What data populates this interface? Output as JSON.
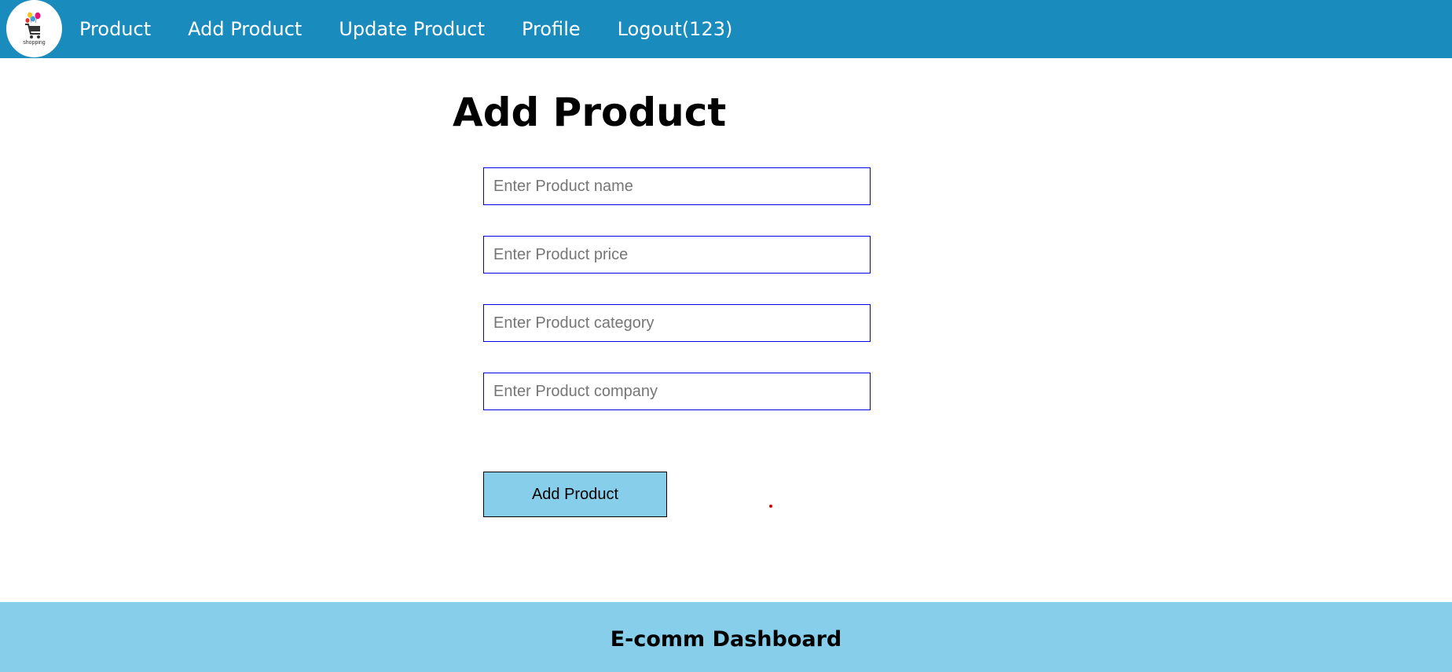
{
  "nav": {
    "logo": {
      "icon": "shopping-cart-balloons-icon",
      "text": "shopping"
    },
    "items": [
      {
        "label": "Product"
      },
      {
        "label": "Add Product"
      },
      {
        "label": "Update Product"
      },
      {
        "label": "Profile"
      },
      {
        "label": "Logout(123)"
      }
    ]
  },
  "main": {
    "title": "Add Product",
    "fields": {
      "name": {
        "value": "",
        "placeholder": "Enter Product name"
      },
      "price": {
        "value": "",
        "placeholder": "Enter Product price"
      },
      "category": {
        "value": "",
        "placeholder": "Enter Product category"
      },
      "company": {
        "value": "",
        "placeholder": "Enter Product company"
      }
    },
    "submit_label": "Add Product"
  },
  "footer": {
    "text": "E-comm Dashboard"
  },
  "colors": {
    "navbar": "#1a8bbd",
    "footer": "#87ceeb",
    "button": "#87ceeb",
    "input_border": "#0000ee"
  }
}
